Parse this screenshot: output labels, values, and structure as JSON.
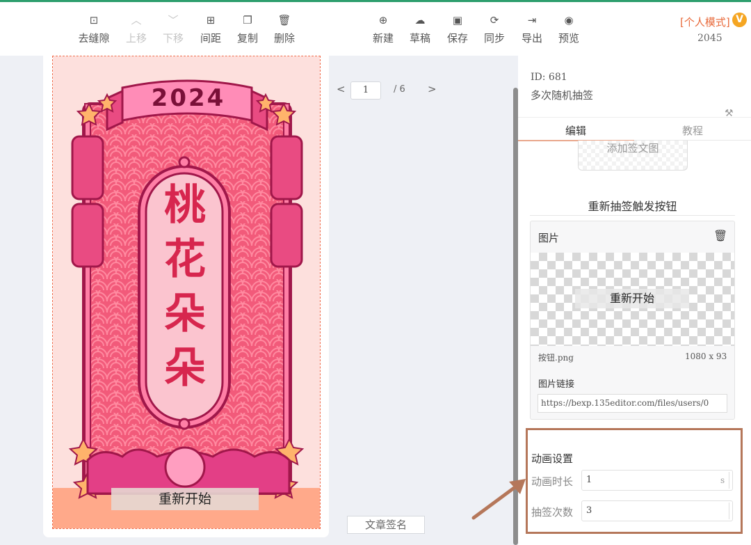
{
  "toolbar": {
    "items": [
      {
        "icon": "grid-icon",
        "glyph": "⊡",
        "label": "去缝隙",
        "enabled": true
      },
      {
        "icon": "chevron-up-icon",
        "glyph": "︿",
        "label": "上移",
        "enabled": false
      },
      {
        "icon": "chevron-down-icon",
        "glyph": "﹀",
        "label": "下移",
        "enabled": false
      },
      {
        "icon": "spacing-icon",
        "glyph": "⊞",
        "label": "间距",
        "enabled": true
      },
      {
        "icon": "copy-icon",
        "glyph": "❐",
        "label": "复制",
        "enabled": true
      },
      {
        "icon": "trash-icon",
        "glyph": "🗑",
        "label": "删除",
        "enabled": true
      },
      {
        "icon": "new-doc-icon",
        "glyph": "⊕",
        "label": "新建",
        "enabled": true
      },
      {
        "icon": "cloud-icon",
        "glyph": "☁",
        "label": "草稿",
        "enabled": true
      },
      {
        "icon": "save-icon",
        "glyph": "▣",
        "label": "保存",
        "enabled": true
      },
      {
        "icon": "sync-icon",
        "glyph": "⟳",
        "label": "同步",
        "enabled": true
      },
      {
        "icon": "export-icon",
        "glyph": "⇥",
        "label": "导出",
        "enabled": true
      },
      {
        "icon": "eye-icon",
        "glyph": "◉",
        "label": "预览",
        "enabled": true
      }
    ],
    "mode_label": "[个人模式]",
    "vip_badge": "V",
    "mode_count": "2045"
  },
  "poster": {
    "year": "2024",
    "title_chars": [
      "桃",
      "花",
      "朵",
      "朵"
    ],
    "restart_button": "重新开始",
    "colors": {
      "bg": "#fde0dd",
      "frame": "#f25a7a",
      "dark": "#a0174a",
      "accent": "#ffb36b"
    }
  },
  "pager": {
    "prev": "<",
    "current": "1",
    "total": "/  6",
    "next": ">"
  },
  "sign_button": "文章签名",
  "panel": {
    "id_text": "ID: 681",
    "name": "多次随机抽签",
    "tabs": [
      {
        "label": "编辑"
      },
      {
        "label": "教程"
      }
    ],
    "add_image_button": "添加签文图",
    "section_title": "重新抽签触发按钮",
    "image_card": {
      "header": "图片",
      "preview_text": "重新开始",
      "file_name": "按钮.png",
      "file_size": "1080 x 93",
      "link_label": "图片链接",
      "link_value": "https://bexp.135editor.com/files/users/0"
    },
    "animation": {
      "title": "动画设置",
      "duration_label": "动画时长",
      "duration_value": "1",
      "duration_unit": "s",
      "count_label": "抽签次数",
      "count_value": "3"
    }
  }
}
